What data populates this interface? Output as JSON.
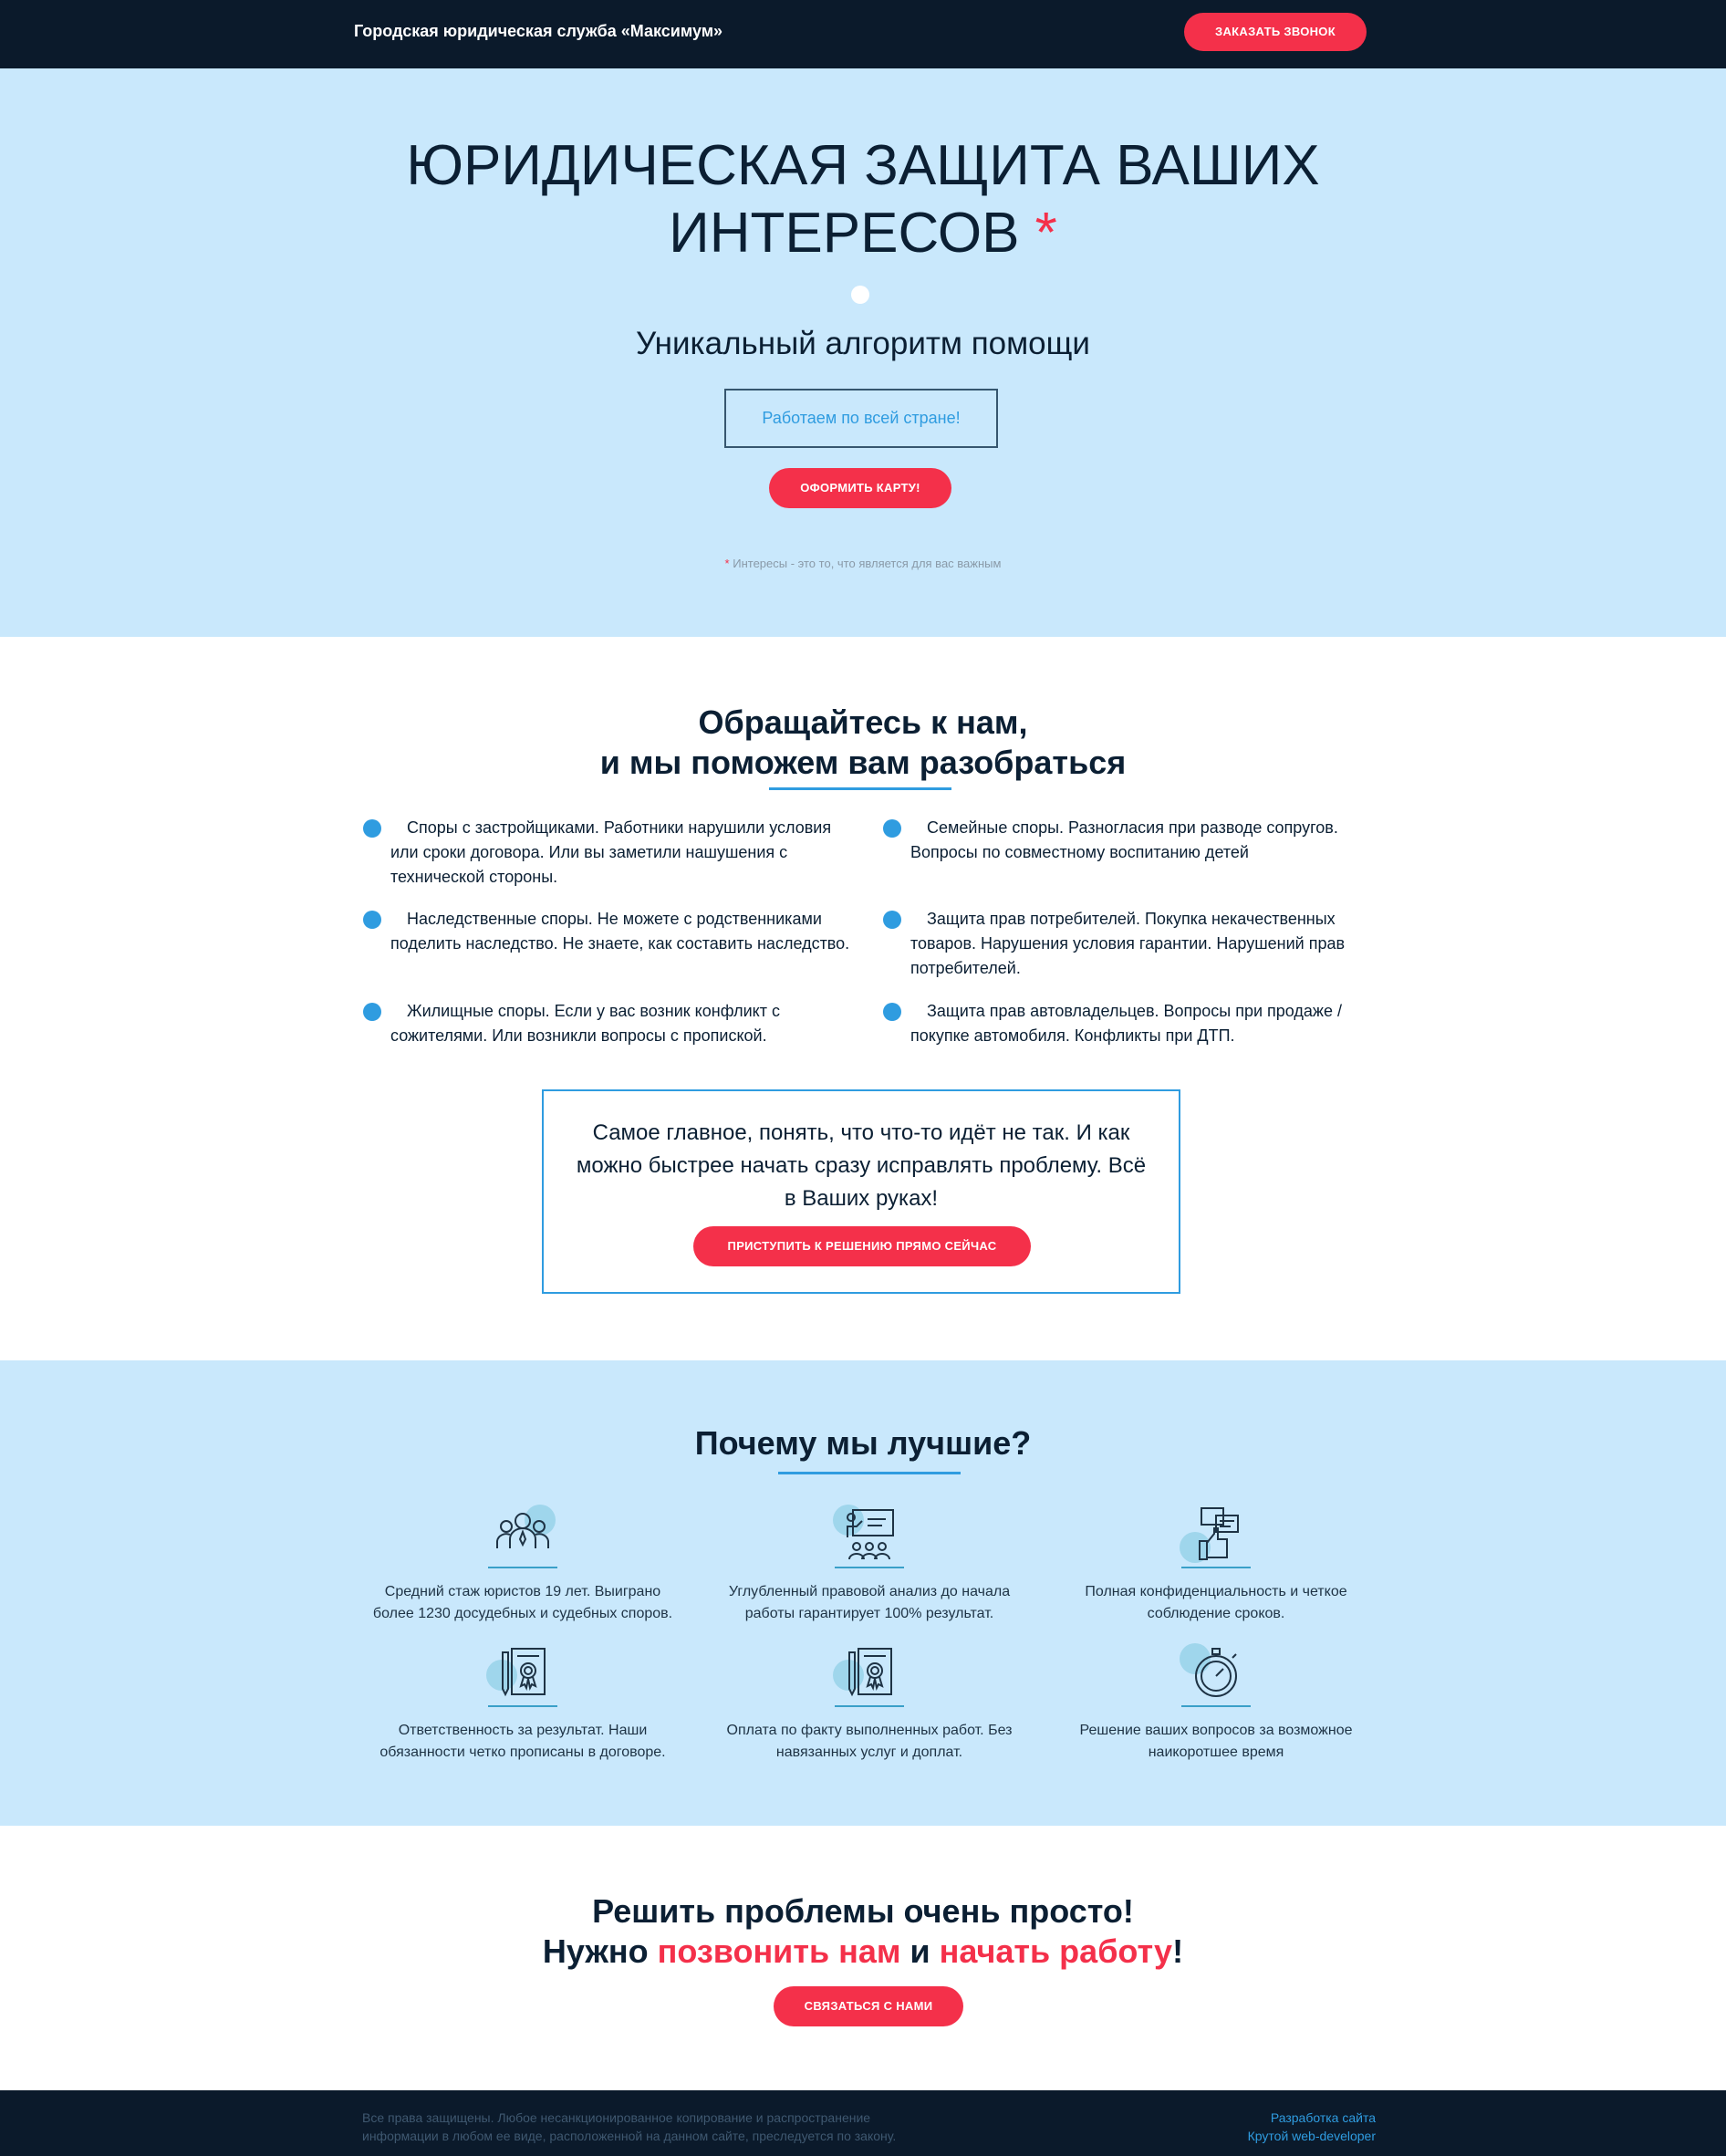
{
  "header": {
    "brand": "Городская юридическая служба «Максимум»",
    "call_button": "ЗАКАЗАТЬ ЗВОНОК"
  },
  "hero": {
    "title_line1": "ЮРИДИЧЕСКАЯ ЗАЩИТА ВАШИХ",
    "title_line2": "ИНТЕРЕСОВ",
    "title_star": "*",
    "subtitle": "Уникальный алгоритм помощи",
    "box_text": "Работаем по всей стране!",
    "button": "ОФОРМИТЬ КАРТУ!",
    "note_star": "*",
    "note": "Интересы - это то, что является для вас важным"
  },
  "help": {
    "title_line1": "Обращайтесь к нам,",
    "title_line2": "и мы поможем вам разобраться",
    "items": [
      "Споры с застройщиками. Работники нарушили условия или сроки договора. Или вы заметили нашушения с технической стороны.",
      "Семейные споры. Разногласия при разводе сопругов. Вопросы по совместному воспитанию детей",
      "Наследственные споры. Не можете с родственниками поделить наследство. Не знаете, как составить наследство.",
      "Защита прав потребителей. Покупка некачественных товаров. Нарушения условия гарантии. Нарушений прав потребителей.",
      "Жилищные споры. Если у вас возник конфликт с сожителями. Или возникли вопросы с пропиской.",
      "Защита прав автовладельцев. Вопросы при продаже / покупке автомобиля. Конфликты при ДТП."
    ],
    "cta_text": "Самое главное, понять, что что-то идёт не так. И как можно быстрее начать сразу исправлять проблему. Всё в Ваших руках!",
    "cta_button": "ПРИСТУПИТЬ К РЕШЕНИЮ ПРЯМО СЕЙЧАС"
  },
  "why": {
    "title": "Почему мы лучшие?",
    "features": [
      {
        "icon": "team-icon",
        "text": "Средний стаж юристов 19 лет. Выиграно более 1230 досудебных и судебных споров."
      },
      {
        "icon": "presentation-icon",
        "text": "Углубленный правовой анализ до начала работы гарантирует 100% результат."
      },
      {
        "icon": "chat-thumbs-up-icon",
        "text": "Полная конфиденциальность и четкое соблюдение сроков."
      },
      {
        "icon": "certificate-icon",
        "text": "Ответственность за результат. Наши обязанности четко прописаны в договоре."
      },
      {
        "icon": "certificate-icon",
        "text": "Оплата по факту выполненных работ. Без навязанных услуг и доплат."
      },
      {
        "icon": "stopwatch-icon",
        "text": "Решение ваших вопросов за возможное наикоротшее время"
      }
    ]
  },
  "final": {
    "line1": "Решить проблемы очень просто!",
    "line2_a": "Нужно ",
    "line2_b": "позвонить нам",
    "line2_c": " и ",
    "line2_d": "начать работу",
    "line2_e": "!",
    "button": "СВЯЗАТЬСЯ С НАМИ"
  },
  "footer": {
    "copyright": "Все права защищены. Любое несанкционированное копирование и распространение информации в любом ее виде, расположенной на данном сайте, преследуется по закону.",
    "dev_line1": "Разработка сайта",
    "dev_line2": "Крутой web-developer"
  },
  "colors": {
    "accent": "#f4304a",
    "dark": "#0b1a2b",
    "light_blue": "#c9e8fc",
    "blue": "#2f9ce0"
  }
}
